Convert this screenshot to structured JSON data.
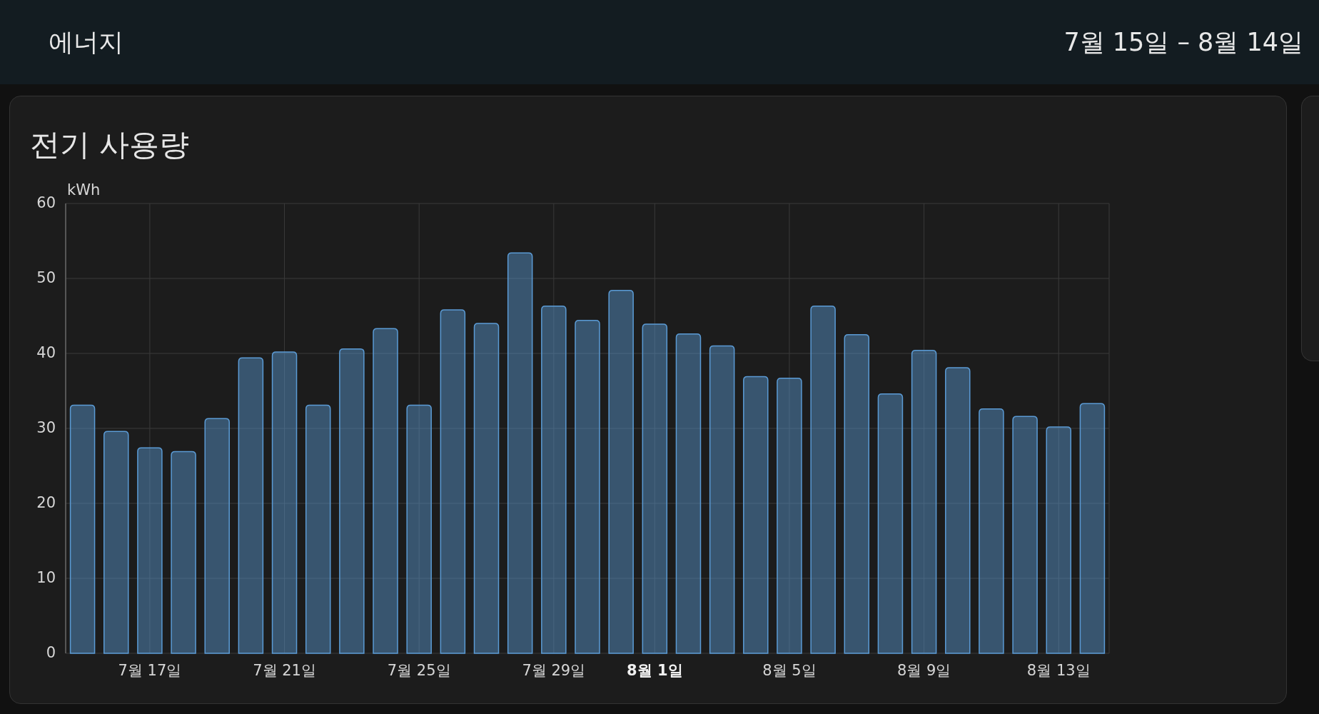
{
  "header": {
    "title": "에너지",
    "date_range": "7월 15일 – 8월 14일"
  },
  "card": {
    "title": "전기 사용량",
    "chart_data": {
      "type": "bar",
      "ylabel": "kWh",
      "ylim": [
        0,
        60
      ],
      "yticks": [
        0,
        10,
        20,
        30,
        40,
        50,
        60
      ],
      "grid": true,
      "categories": [
        null,
        null,
        "7월 17일",
        null,
        null,
        null,
        "7월 21일",
        null,
        null,
        null,
        "7월 25일",
        null,
        null,
        null,
        "7월 29일",
        null,
        null,
        "**8월 1일**",
        null,
        null,
        null,
        "8월 5일",
        null,
        null,
        null,
        "8월 9일",
        null,
        null,
        null,
        "8월 13일",
        null
      ],
      "series": [
        {
          "color": "#5b9bd5",
          "values": [
            33.1,
            29.6,
            27.4,
            26.9,
            31.3,
            39.4,
            40.2,
            33.1,
            40.6,
            43.3,
            33.1,
            45.8,
            44.0,
            53.4,
            46.3,
            44.4,
            48.4,
            43.9,
            42.6,
            41.0,
            36.9,
            36.7,
            46.3,
            42.5,
            34.6,
            40.4,
            38.1,
            32.6,
            31.6,
            30.2,
            33.3
          ]
        }
      ]
    }
  }
}
